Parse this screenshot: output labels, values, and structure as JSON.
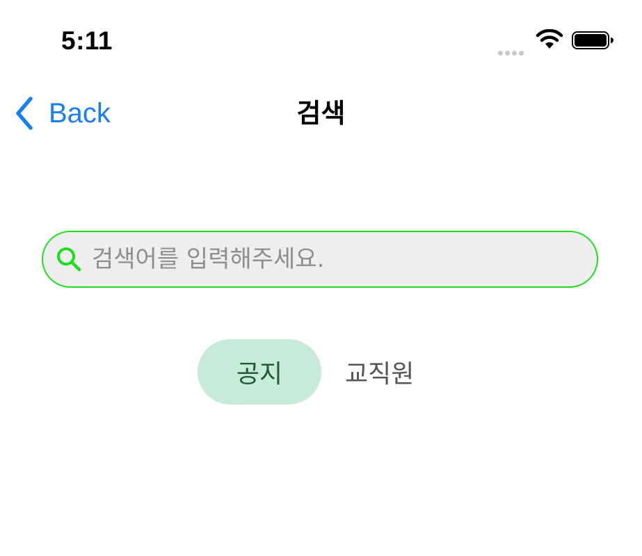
{
  "status_bar": {
    "time": "5:11",
    "signal_icon": "signal-dots-icon",
    "wifi_icon": "wifi-icon",
    "battery_icon": "battery-icon"
  },
  "nav": {
    "back_label": "Back",
    "back_icon": "chevron-left-icon",
    "title": "검색",
    "accent_color": "#1a7ef2"
  },
  "search": {
    "placeholder": "검색어를 입력해주세요.",
    "value": "",
    "icon": "search-icon",
    "border_color": "#1edd1e",
    "background_color": "#eeeeee"
  },
  "tabs": [
    {
      "label": "공지",
      "selected": true,
      "bg_color": "#c8ead9",
      "text_color": "#1d5b39"
    },
    {
      "label": "교직원",
      "selected": false,
      "text_color": "#555555"
    }
  ]
}
